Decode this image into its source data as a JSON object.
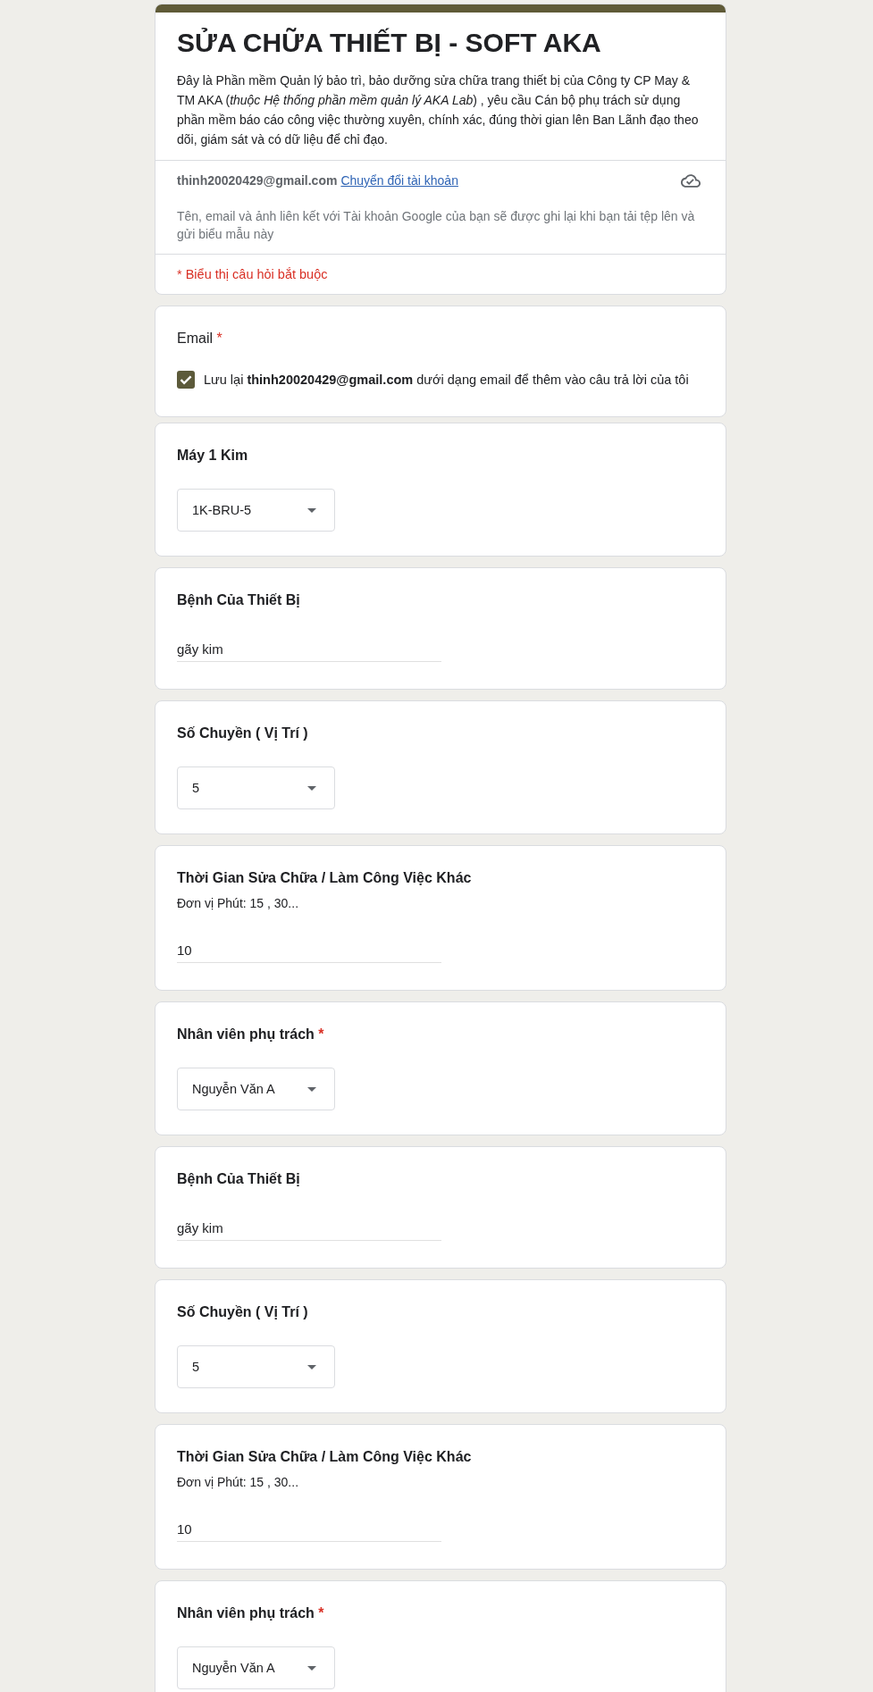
{
  "header": {
    "title": "SỬA CHỮA THIẾT BỊ - SOFT AKA",
    "description": "Đây là Phần mềm Quản lý bảo trì, bảo dưỡng sửa chữa trang thiết bị của Công ty CP May & TM AKA (*thuộc Hệ thống phần mềm quản lý AKA Lab*) , yêu cầu Cán bộ phụ trách sử dụng phần mềm báo cáo công việc thường xuyên, chính xác, đúng thời gian lên Ban Lãnh đạo theo dõi, giám sát và có dữ liệu để chỉ đạo.",
    "account": {
      "email": "thinh20020429@gmail.com",
      "switch_link": "Chuyển đổi tài khoản"
    },
    "notice": "Tên, email và ảnh liên kết với Tài khoản Google của bạn sẽ được ghi lại khi bạn tải tệp lên và gửi biểu mẫu này",
    "required_note": "* Biểu thị câu hỏi bắt buộc"
  },
  "email_question": {
    "label": "Email",
    "required_mark": "*",
    "checkbox": {
      "label": "Lưu lại **thinh20020429@gmail.com** dưới dạng email để thêm vào câu trả lời của tôi",
      "checked": true
    }
  },
  "questions": [
    {
      "kind": "dropdown",
      "title": "Máy 1 Kim",
      "value": "1K-BRU-5"
    },
    {
      "kind": "text",
      "title": "Bệnh Của Thiết Bị",
      "value": "gãy kim"
    },
    {
      "kind": "dropdown",
      "title": "Số Chuyền ( Vị Trí )",
      "value": "5"
    },
    {
      "kind": "text",
      "title": "Thời Gian Sửa Chữa / Làm Công Việc Khác",
      "description": "Đơn vị Phút: 15 , 30...",
      "value": "10"
    },
    {
      "kind": "dropdown",
      "title": "Nhân viên phụ trách",
      "required_mark": "*",
      "value": "Nguyễn Văn A"
    },
    {
      "kind": "text",
      "title": "Bệnh Của Thiết Bị",
      "value": "gãy kim"
    },
    {
      "kind": "dropdown",
      "title": "Số Chuyền ( Vị Trí )",
      "value": "5"
    },
    {
      "kind": "text",
      "title": "Thời Gian Sửa Chữa / Làm Công Việc Khác",
      "description": "Đơn vị Phút: 15 , 30...",
      "value": "10"
    },
    {
      "kind": "dropdown",
      "title": "Nhân viên phụ trách",
      "required_mark": "*",
      "value": "Nguyễn Văn A"
    }
  ]
}
